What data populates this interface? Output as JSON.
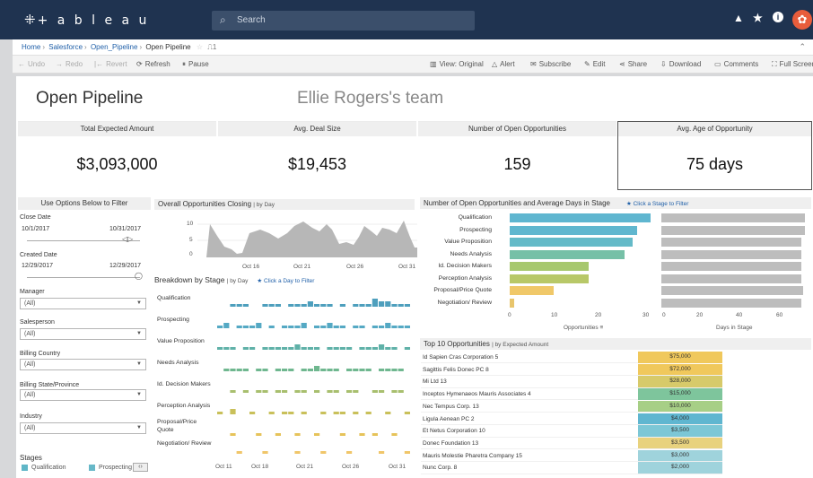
{
  "app": {
    "logo": "+ a b l e a u",
    "search_placeholder": "Search",
    "icons": [
      "alert-triangle-icon",
      "star-icon",
      "info-icon",
      "avatar-icon"
    ]
  },
  "breadcrumbs": [
    "Home",
    "Salesforce",
    "Open_Pipeline",
    "Open Pipeline"
  ],
  "favorite_count": "1",
  "toolbar": {
    "undo": "Undo",
    "redo": "Redo",
    "revert": "Revert",
    "refresh": "Refresh",
    "pause": "Pause",
    "view": "View: Original",
    "alert": "Alert",
    "subscribe": "Subscribe",
    "edit": "Edit",
    "share": "Share",
    "download": "Download",
    "comments": "Comments",
    "fullscreen": "Full Screen"
  },
  "dashboard": {
    "title": "Open Pipeline",
    "team": "Ellie Rogers's team",
    "kpis": [
      {
        "label": "Total Expected Amount",
        "value": "$3,093,000"
      },
      {
        "label": "Avg. Deal Size",
        "value": "$19,453"
      },
      {
        "label": "Number of Open Opportunities",
        "value": "159"
      },
      {
        "label": "Avg. Age of Opportunity",
        "value": "75 days"
      }
    ]
  },
  "filters": {
    "title": "Use Options Below to Filter",
    "close_date": {
      "label": "Close Date",
      "from": "10/1/2017",
      "to": "10/31/2017"
    },
    "created_date": {
      "label": "Created Date",
      "from": "12/29/2017",
      "to": "12/29/2017"
    },
    "dropdowns": [
      {
        "label": "Manager",
        "value": "(All)"
      },
      {
        "label": "Salesperson",
        "value": "(All)"
      },
      {
        "label": "Billing Country",
        "value": "(All)"
      },
      {
        "label": "Billing State/Province",
        "value": "(All)"
      },
      {
        "label": "Industry",
        "value": "(All)"
      }
    ],
    "stages_legend": {
      "label": "Stages",
      "items": [
        "Qualification",
        "Prospecting"
      ],
      "colors": [
        "#5fb6c7",
        "#67b8c8"
      ]
    }
  },
  "closing_chart": {
    "title": "Overall Opportunities Closing",
    "subtitle": "by Day",
    "y_ticks": [
      "10",
      "5",
      "0"
    ],
    "x_ticks": [
      "Oct 16",
      "Oct 21",
      "Oct 26",
      "Oct 31"
    ]
  },
  "breakdown": {
    "title": "Breakdown by Stage",
    "subtitle": "by Day",
    "link": "★ Click a Day to Filter",
    "stages": [
      "Qualification",
      "Prospecting",
      "Value Proposition",
      "Needs Analysis",
      "Id. Decision Makers",
      "Perception Analysis",
      "Proposal/Price Quote",
      "Negotiation/ Review"
    ],
    "colors": [
      "#4e9fbd",
      "#55a9c4",
      "#5fb1a8",
      "#6fb78f",
      "#a8bf6e",
      "#c9c05a",
      "#e6c35a",
      "#f0c66a"
    ],
    "x_ticks": [
      "Oct 11",
      "Oct 18",
      "Oct 21",
      "Oct 26",
      "Oct 31"
    ]
  },
  "stage_chart": {
    "title": "Number of Open Opportunities and Average Days in Stage",
    "link": "★ Click a Stage to Filter",
    "x1_ticks": [
      "0",
      "10",
      "20",
      "30"
    ],
    "x2_ticks": [
      "0",
      "20",
      "40",
      "60"
    ],
    "x1_label": "Opportunities",
    "x2_label": "Days in Stage"
  },
  "chart_data": {
    "type": "bar",
    "categories": [
      "Qualification",
      "Prospecting",
      "Value Proposition",
      "Needs Analysis",
      "Id. Decision Makers",
      "Perception Analysis",
      "Proposal/Price Quote",
      "Negotiation/ Review"
    ],
    "series": [
      {
        "name": "Opportunities",
        "values": [
          32,
          29,
          28,
          26,
          18,
          18,
          10,
          1
        ]
      },
      {
        "name": "Days in Stage",
        "values": [
          72,
          72,
          70,
          70,
          70,
          70,
          71,
          70
        ]
      }
    ],
    "colors": [
      "#5fb6d0",
      "#60b7cf",
      "#64bac8",
      "#76c0a7",
      "#a7c86e",
      "#b8c868",
      "#f0c869",
      "#e8c56c"
    ],
    "ylim_opportunities": [
      0,
      30
    ],
    "ylim_days": [
      0,
      60
    ]
  },
  "top10": {
    "title": "Top 10 Opportunities",
    "subtitle": "by Expected Amount",
    "rows": [
      {
        "name": "Id Sapien Cras Corporation 5",
        "amount": "$75,000",
        "color": "#f0c85c"
      },
      {
        "name": "Sagittis Felis Donec PC 8",
        "amount": "$72,000",
        "color": "#f0c85c"
      },
      {
        "name": "Mi Ltd 13",
        "amount": "$28,000",
        "color": "#d7ca6a"
      },
      {
        "name": "Inceptos Hymenaeos Mauris Associates 4",
        "amount": "$15,000",
        "color": "#7ec59c"
      },
      {
        "name": "Nec Tempus Corp. 13",
        "amount": "$10,000",
        "color": "#a7cf86"
      },
      {
        "name": "Ligula Aenean PC 2",
        "amount": "$4,000",
        "color": "#5fb6d0"
      },
      {
        "name": "Et Netus Corporation 10",
        "amount": "$3,500",
        "color": "#7cc7d6"
      },
      {
        "name": "Donec Foundation 13",
        "amount": "$3,500",
        "color": "#e8d27e"
      },
      {
        "name": "Mauris Molestie Pharetra Company 15",
        "amount": "$3,000",
        "color": "#9fd3dc"
      },
      {
        "name": "Nunc Corp. 8",
        "amount": "$2,000",
        "color": "#9fd3dc"
      }
    ]
  }
}
